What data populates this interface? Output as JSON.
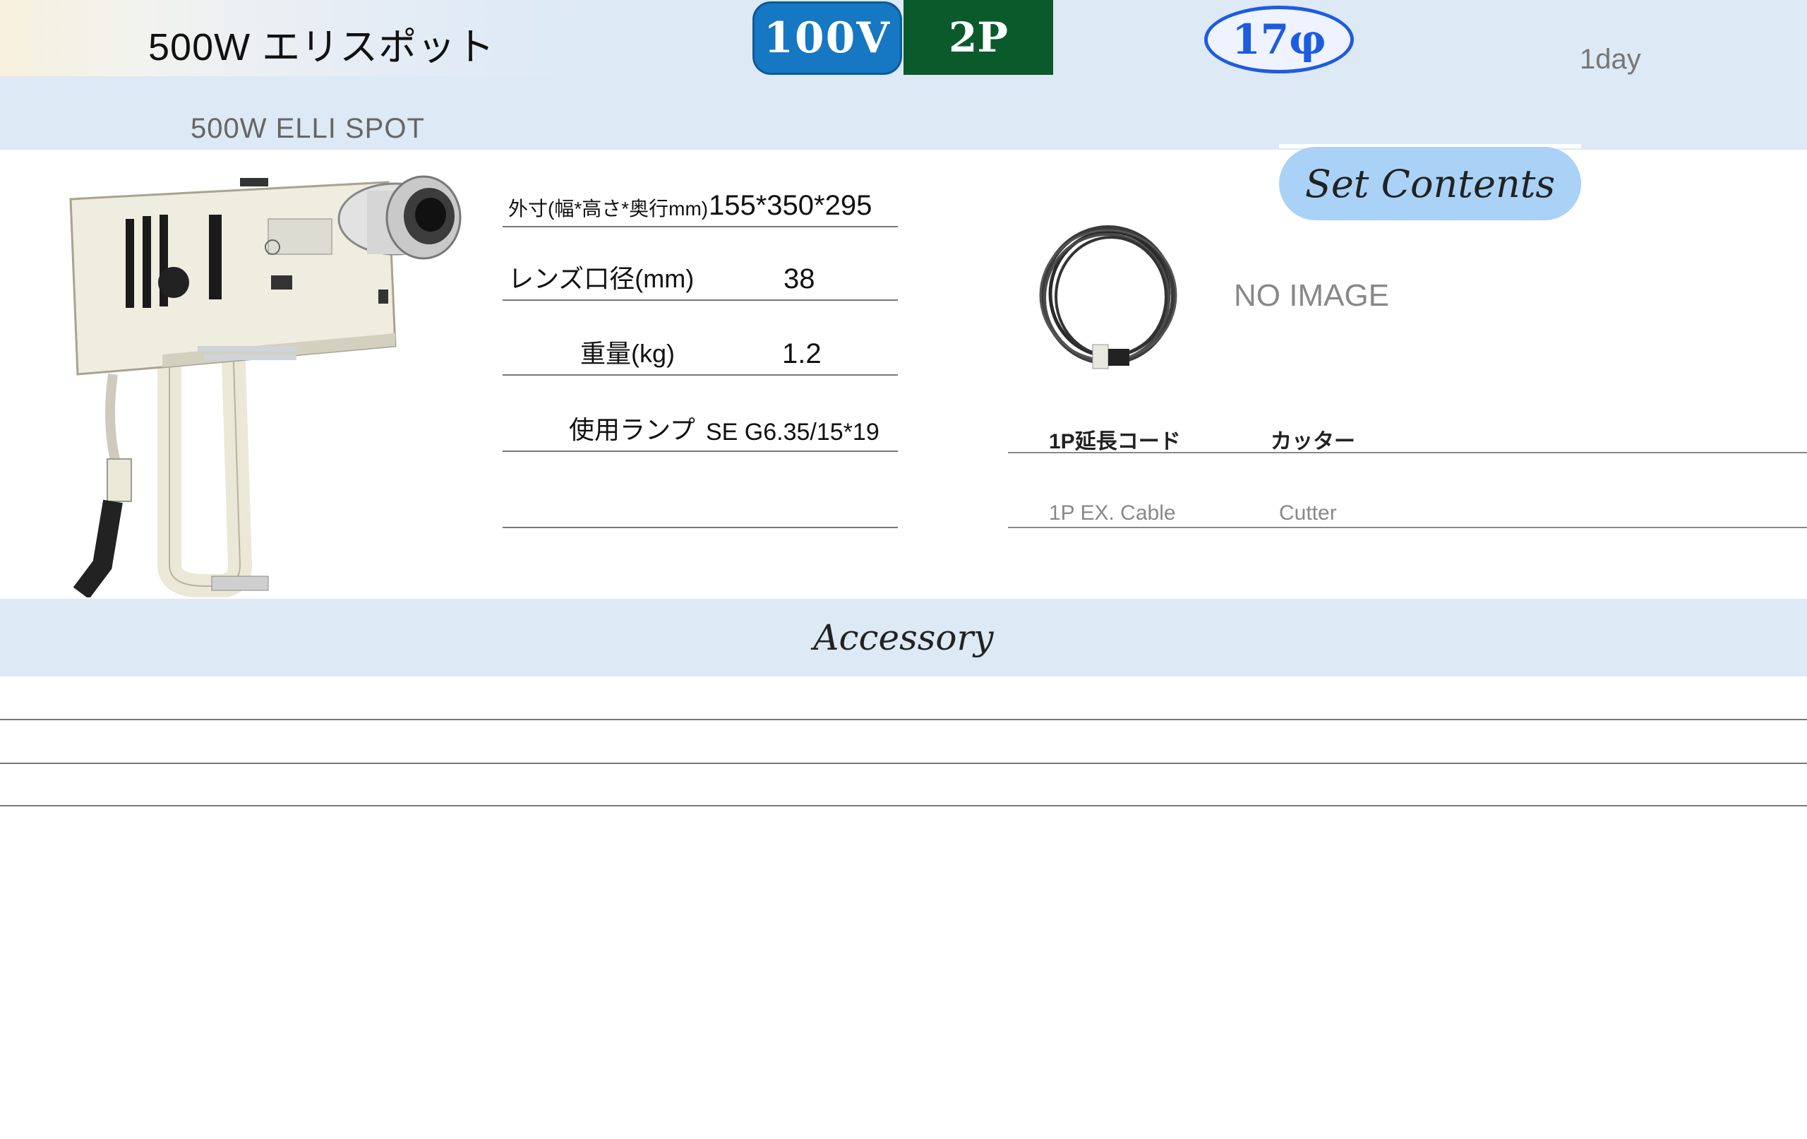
{
  "header": {
    "title_jp": "500W エリスポット",
    "title_en": "500W ELLI SPOT",
    "voltage_badge": "100V",
    "plug_badge": "2P",
    "diameter_badge": "17φ",
    "rental_period": "1day",
    "colors": {
      "voltage": "#1677c2",
      "plug": "#0b5a2c",
      "diameter": "#1d5be0",
      "band": "#dde9f5"
    }
  },
  "product": {
    "image_icon": "ellipsoidal-spotlight-photo"
  },
  "specs": [
    {
      "label": "外寸(幅*高さ*奥行mm)",
      "value": "155*350*295"
    },
    {
      "label": "レンズ口径(mm)",
      "value": "38"
    },
    {
      "label": "重量(kg)",
      "value": "1.2"
    },
    {
      "label": "使用ランプ",
      "value": "SE G6.35/15*19"
    },
    {
      "label": "",
      "value": ""
    }
  ],
  "set_contents": {
    "heading": "Set Contents",
    "no_image_text": "NO IMAGE",
    "cable_icon": "extension-cable-photo",
    "items": [
      {
        "name": "1P延長コード",
        "name_en": "1P EX. Cable"
      },
      {
        "name": "カッター",
        "name_en": "Cutter"
      }
    ]
  },
  "accessory": {
    "heading": "Accessory",
    "rows": [
      "",
      "",
      ""
    ]
  }
}
